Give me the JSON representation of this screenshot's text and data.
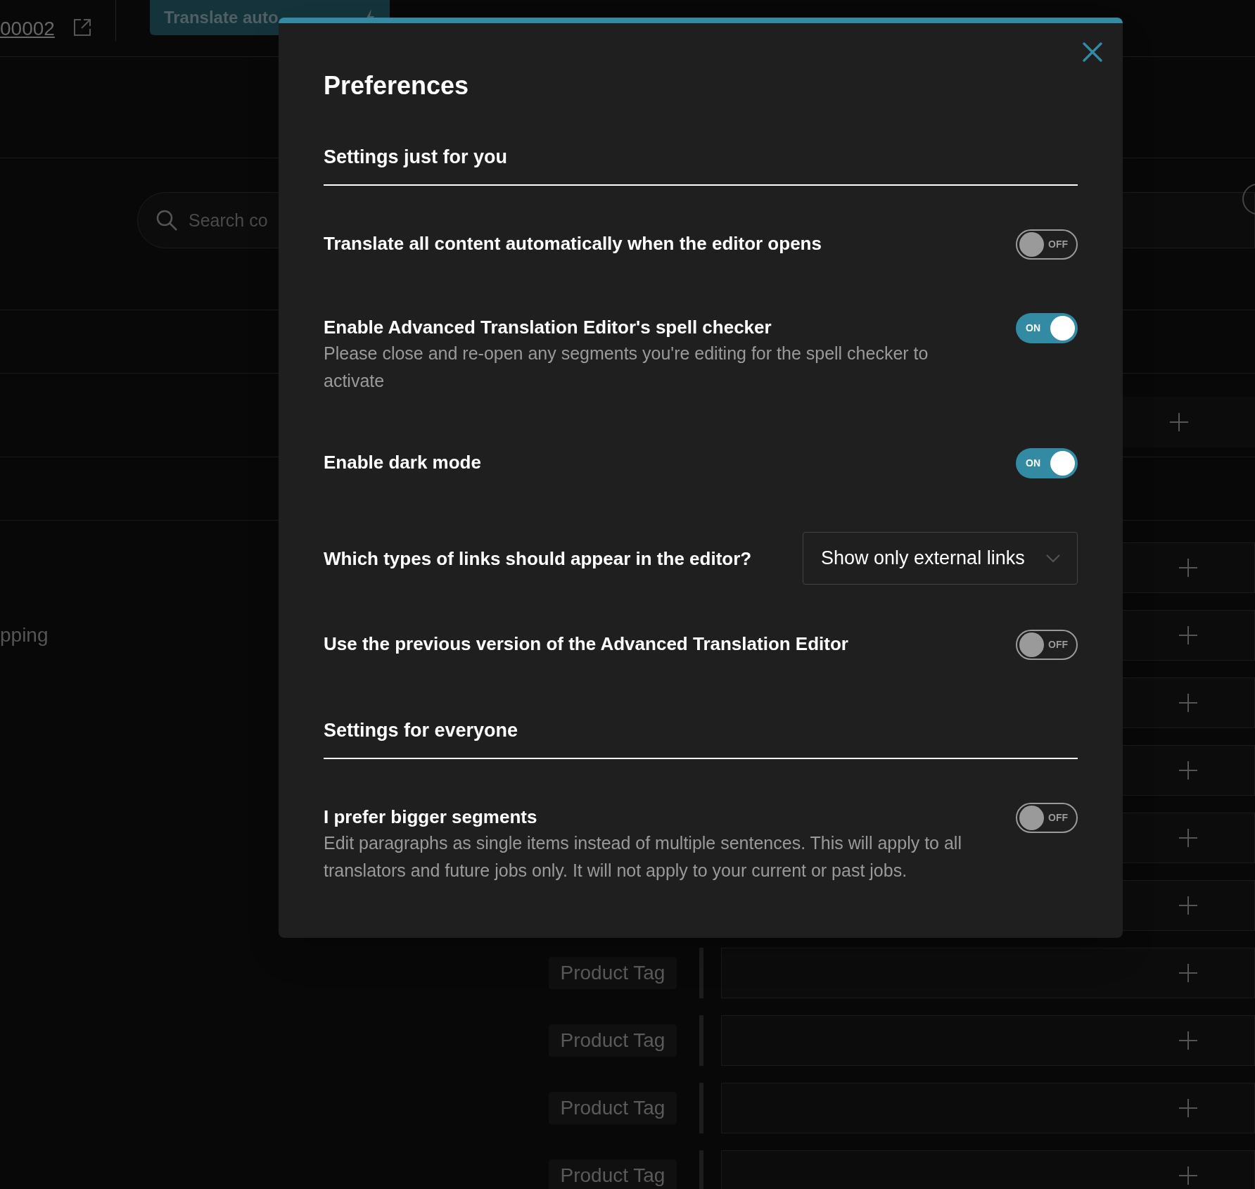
{
  "topbar": {
    "link": "00002",
    "button": "Translate auto"
  },
  "search": {
    "placeholder": "Search co"
  },
  "rows": [
    {},
    {
      "label": "pping"
    },
    {},
    {},
    {},
    {},
    {
      "tag": "Product Tag"
    },
    {
      "tag": "Product Tag"
    },
    {
      "tag": "Product Tag"
    },
    {
      "tag": "Product Tag"
    }
  ],
  "dialog": {
    "title": "Preferences",
    "sections": [
      {
        "heading": "Settings just for you",
        "settings": [
          {
            "kind": "toggle",
            "label": "Translate all content automatically when the editor opens",
            "on": false,
            "state_text": "OFF"
          },
          {
            "kind": "toggle",
            "label": "Enable Advanced Translation Editor's spell checker",
            "description": "Please close and re-open any segments you're editing for the spell checker to activate",
            "on": true,
            "state_text": "ON"
          },
          {
            "kind": "toggle",
            "label": "Enable dark mode",
            "on": true,
            "state_text": "ON"
          },
          {
            "kind": "select",
            "label": "Which types of links should appear in the editor?",
            "value": "Show only external links"
          },
          {
            "kind": "toggle",
            "label": "Use the previous version of the Advanced Translation Editor",
            "on": false,
            "state_text": "OFF"
          }
        ]
      },
      {
        "heading": "Settings for everyone",
        "settings": [
          {
            "kind": "toggle",
            "label": "I prefer bigger segments",
            "description": "Edit paragraphs as single items instead of multiple sentences. This will apply to all translators and future jobs only. It will not apply to your current or past jobs.",
            "on": false,
            "state_text": "OFF"
          }
        ]
      }
    ]
  }
}
